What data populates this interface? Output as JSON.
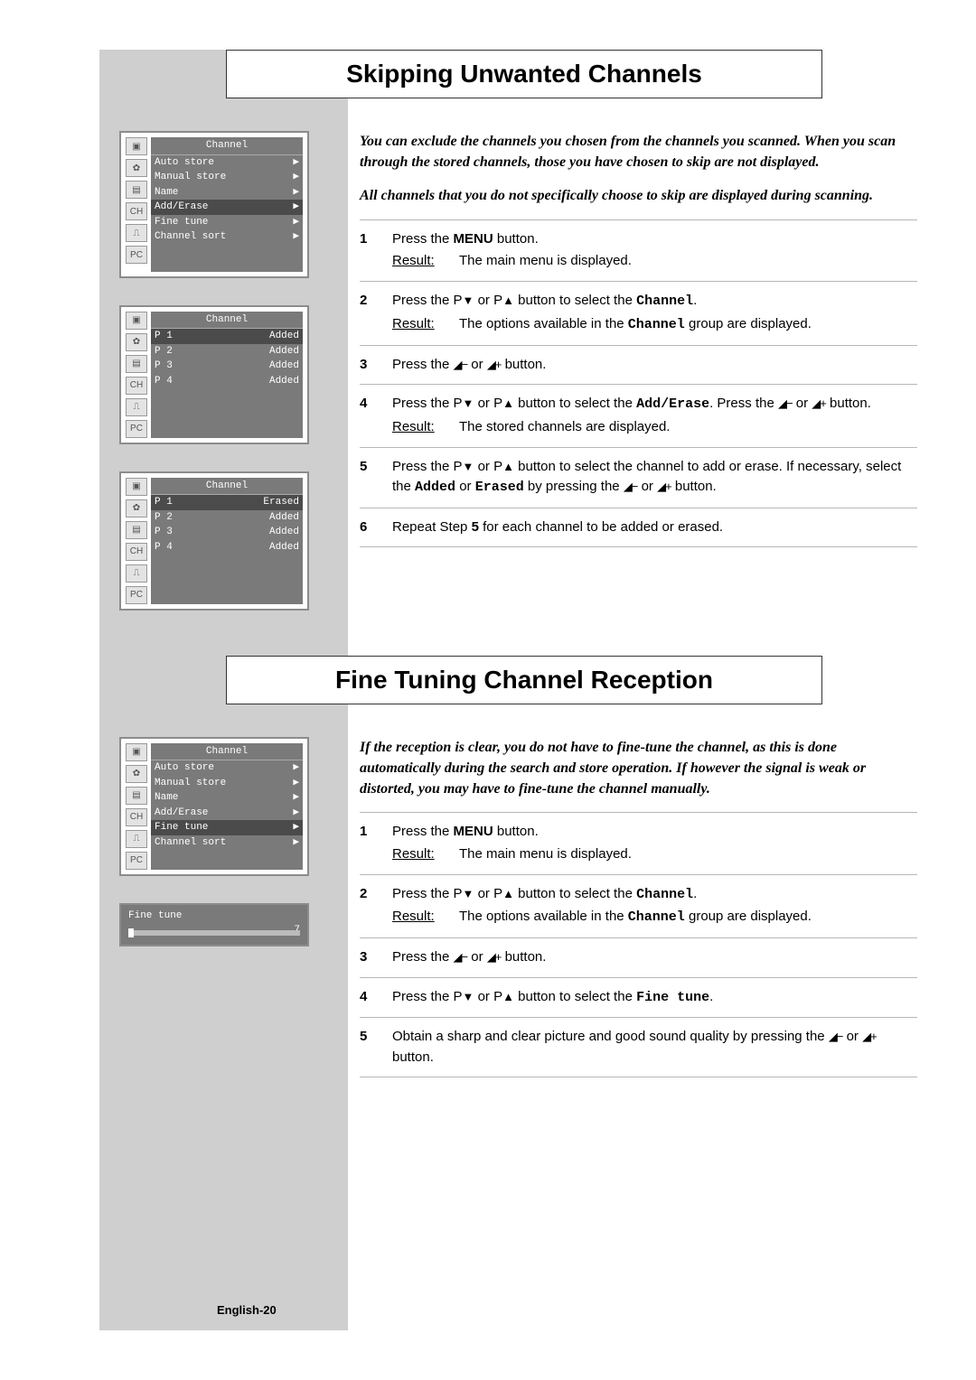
{
  "titles": {
    "skip": "Skipping Unwanted Channels",
    "fine": "Fine Tuning Channel Reception"
  },
  "osd_header": "Channel",
  "osd_menu": {
    "auto": "Auto store",
    "manual": "Manual store",
    "name": "Name",
    "adderase": "Add/Erase",
    "fine": "Fine tune",
    "sort": "Channel sort"
  },
  "icons": {
    "tv": "▣",
    "tools": "✿",
    "doc": "▤",
    "ch": "CH",
    "ant": "⎍",
    "pc": "PC"
  },
  "chlist": {
    "p1a": "P 1",
    "p2": "P 2",
    "p3": "P 3",
    "p4": "P 4",
    "added": "Added",
    "erased": "Erased"
  },
  "finebox": {
    "label": "Fine tune",
    "value": "7"
  },
  "skip_intro1": "You can exclude the channels you chosen from the channels you scanned. When you scan through the stored channels, those you have chosen to skip are not displayed.",
  "skip_intro2": "All channels that you do not specifically choose to skip are displayed during scanning.",
  "fine_intro": "If the reception is clear, you do not have to fine-tune the channel, as this is done automatically during the search and store operation. If however the signal is weak or distorted, you may have to fine-tune the channel manually.",
  "terms": {
    "menu": "MENU",
    "channel": "Channel",
    "adderase": "Add/Erase",
    "added": "Added",
    "erased": "Erased",
    "fine": "Fine tune"
  },
  "results": {
    "main": "The main menu is displayed.",
    "chopts": "The options available in the Channel group are displayed.",
    "stored": "The stored channels are displayed."
  },
  "foot": "English-20"
}
